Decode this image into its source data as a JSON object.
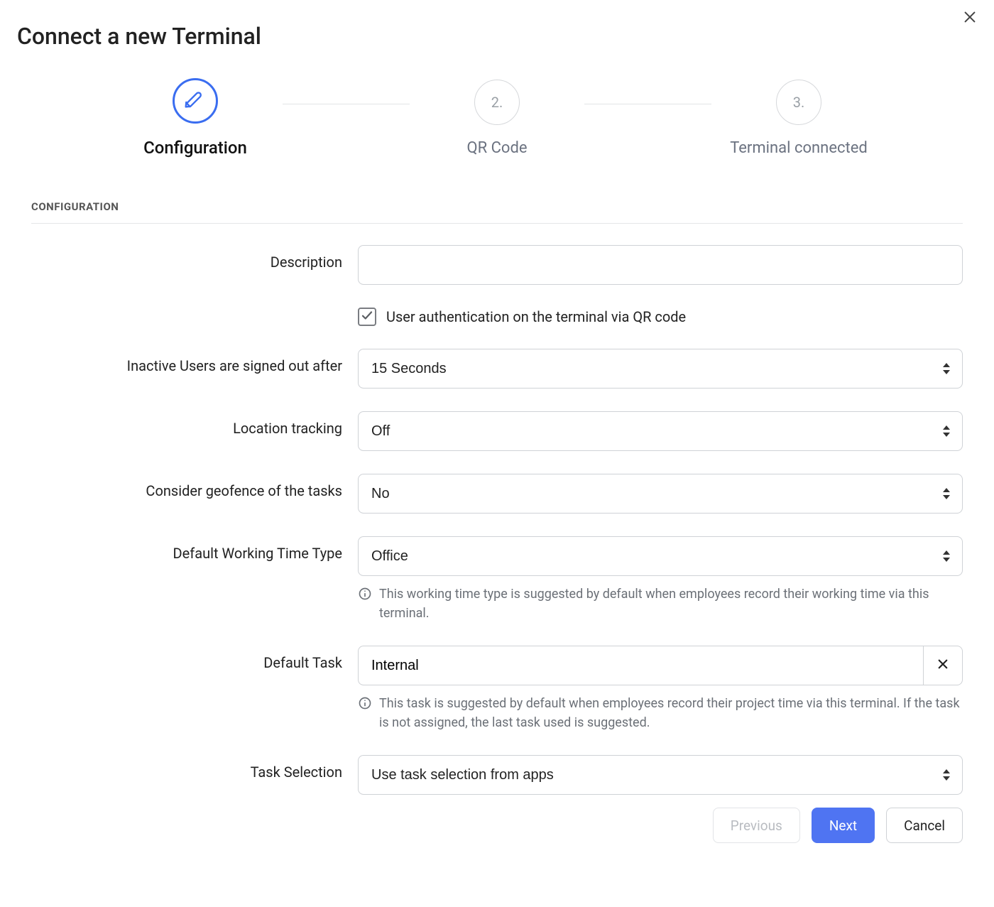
{
  "dialog": {
    "title": "Connect a new Terminal"
  },
  "stepper": {
    "steps": [
      {
        "label": "Configuration"
      },
      {
        "number": "2.",
        "label": "QR Code"
      },
      {
        "number": "3.",
        "label": "Terminal connected"
      }
    ]
  },
  "section": {
    "heading": "CONFIGURATION"
  },
  "form": {
    "description": {
      "label": "Description",
      "value": ""
    },
    "qr_auth": {
      "label": "User authentication on the terminal via QR code",
      "checked": true
    },
    "signout": {
      "label": "Inactive Users are signed out after",
      "value": "15 Seconds"
    },
    "location": {
      "label": "Location tracking",
      "value": "Off"
    },
    "geofence": {
      "label": "Consider geofence of the tasks",
      "value": "No"
    },
    "default_wtt": {
      "label": "Default Working Time Type",
      "value": "Office",
      "helper": "This working time type is suggested by default when employees record their working time via this terminal."
    },
    "default_task": {
      "label": "Default Task",
      "value": "Internal",
      "helper": "This task is suggested by default when employees record their project time via this terminal. If the task is not assigned, the last task used is suggested."
    },
    "task_selection": {
      "label": "Task Selection",
      "value": "Use task selection from apps"
    }
  },
  "footer": {
    "previous": "Previous",
    "next": "Next",
    "cancel": "Cancel"
  }
}
